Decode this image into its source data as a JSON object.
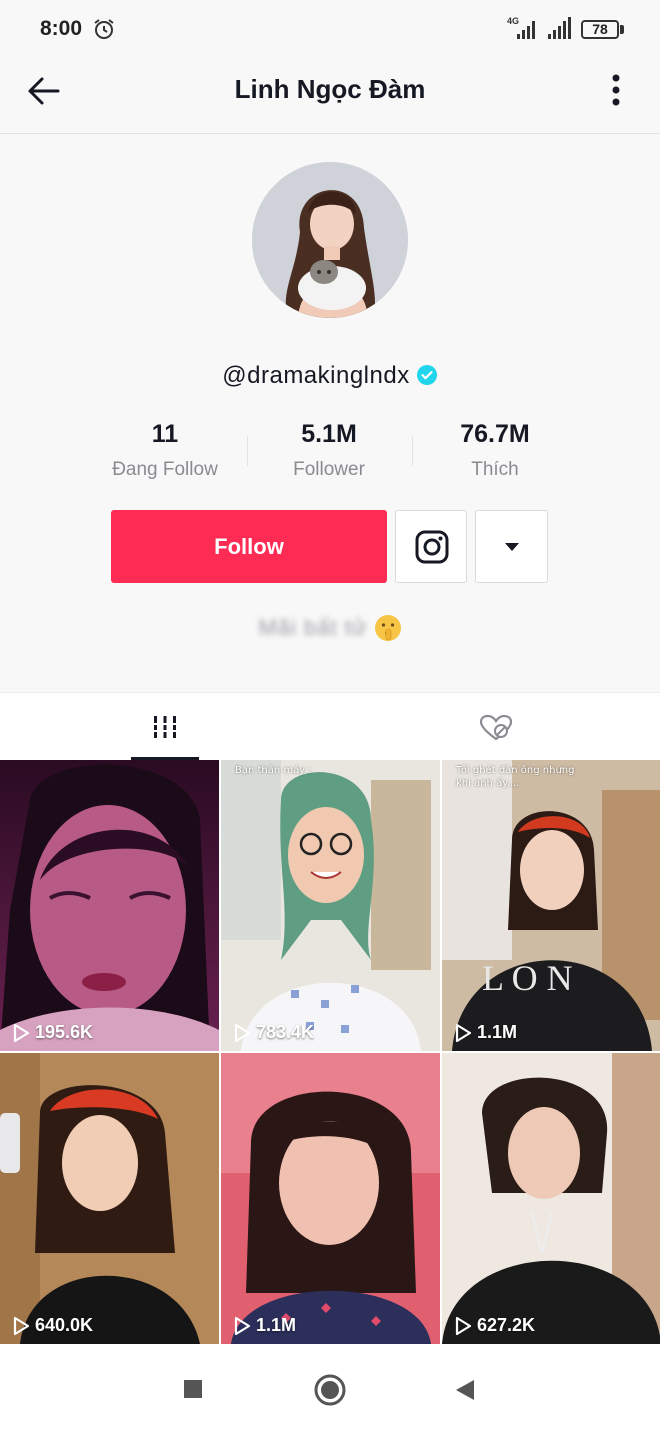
{
  "status_bar": {
    "time": "8:00",
    "network": "4G",
    "battery": "78"
  },
  "header": {
    "title": "Linh Ngọc Đàm"
  },
  "profile": {
    "username": "@dramakinglndx",
    "stats": [
      {
        "value": "11",
        "label": "Đang Follow"
      },
      {
        "value": "5.1M",
        "label": "Follower"
      },
      {
        "value": "76.7M",
        "label": "Thích"
      }
    ],
    "follow_label": "Follow",
    "bio": "Mãi bất tử",
    "accent_color": "#fe2c55",
    "verified_color": "#20d5ec"
  },
  "tabs": [
    {
      "icon": "grid-icon",
      "selected": true
    },
    {
      "icon": "liked-hidden-icon",
      "selected": false
    }
  ],
  "videos": [
    {
      "views": "195.6K",
      "caption": ""
    },
    {
      "views": "783.4K",
      "caption": "Bạn thân máy :"
    },
    {
      "views": "1.1M",
      "caption": "Tôi ghét đàn ông nhưng khi anh ấy...."
    },
    {
      "views": "640.0K",
      "caption": ""
    },
    {
      "views": "1.1M",
      "caption": ""
    },
    {
      "views": "627.2K",
      "caption": ""
    }
  ]
}
